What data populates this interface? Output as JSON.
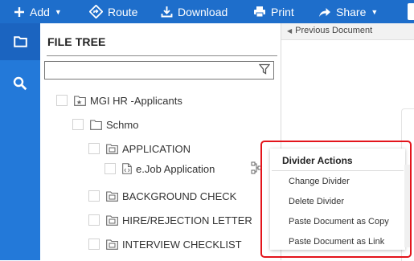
{
  "toolbar": {
    "add_label": "Add",
    "add_caret": "▼",
    "route_label": "Route",
    "download_label": "Download",
    "print_label": "Print",
    "share_label": "Share",
    "share_caret": "▼"
  },
  "rail": {
    "items": [
      "folder-icon",
      "search-icon"
    ]
  },
  "file_tree": {
    "title": "FILE TREE",
    "filter_value": "",
    "nodes": [
      {
        "label": "MGI HR -Applicants",
        "icon": "cabinet-icon"
      },
      {
        "label": "Schmo",
        "icon": "folder-icon"
      },
      {
        "label": "APPLICATION",
        "icon": "divider-folder-icon"
      },
      {
        "label": "e.Job Application",
        "icon": "document-icon"
      },
      {
        "label": "BACKGROUND CHECK",
        "icon": "divider-folder-icon"
      },
      {
        "label": "HIRE/REJECTION LETTER",
        "icon": "divider-folder-icon"
      },
      {
        "label": "INTERVIEW CHECKLIST",
        "icon": "divider-folder-icon"
      }
    ]
  },
  "viewer": {
    "previous_document_label": "Previous Document"
  },
  "context_menu": {
    "title": "Divider Actions",
    "items": [
      "Change Divider",
      "Delete Divider",
      "Paste Document as Copy",
      "Paste Document as Link"
    ]
  },
  "colors": {
    "toolbar_bg": "#1e6ecb",
    "rail_bg": "#2379d9",
    "rail_active_bg": "#1b64c0",
    "highlight_border": "#e3141b"
  }
}
